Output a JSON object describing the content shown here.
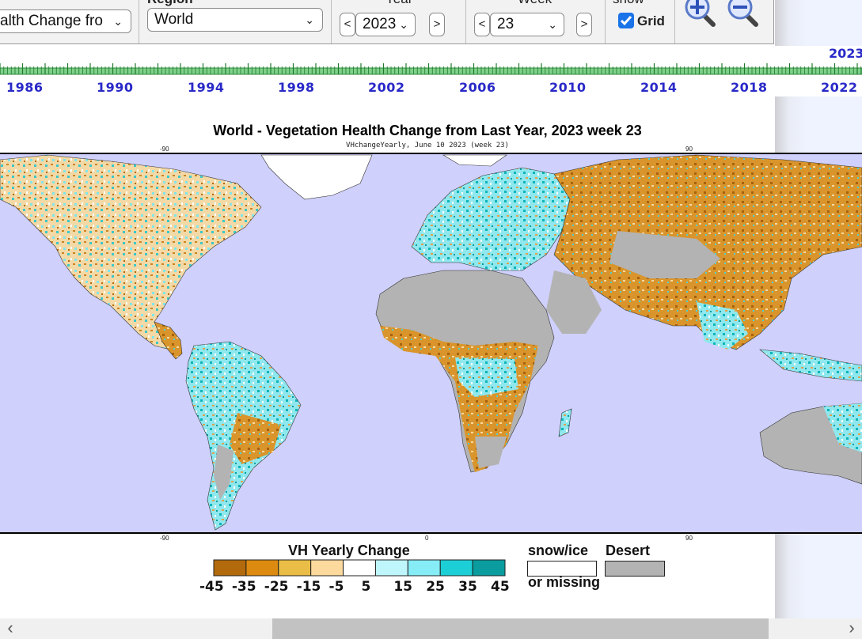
{
  "toolbar": {
    "product_value": "alth Change fro",
    "region_label": "Region",
    "region_value": "World",
    "year_label": "Year",
    "year_value": "2023",
    "week_label": "Week",
    "week_value": "23",
    "show_label": "show",
    "grid_label": "Grid",
    "grid_checked": true,
    "prev_symbol": "<",
    "next_symbol": ">"
  },
  "timeline": {
    "years": [
      "1986",
      "1990",
      "1994",
      "1998",
      "2002",
      "2006",
      "2010",
      "2014",
      "2018",
      "2022"
    ],
    "current_year": "2023"
  },
  "map": {
    "title": "World - Vegetation Health Change from Last Year, 2023 week 23",
    "subtitle": "VHchangeYearly,  June 10 2023 (week 23)",
    "lon_labels_top": [
      "-90",
      "90"
    ],
    "lon_labels_bottom": [
      "-90",
      "0",
      "90"
    ]
  },
  "legend": {
    "title": "VH Yearly Change",
    "ticks": [
      "-45",
      "-35",
      "-25",
      "-15",
      "-5",
      "5",
      "15",
      "25",
      "35",
      "45"
    ],
    "colors": [
      "#b26a0c",
      "#dd8a10",
      "#eabd46",
      "#fcd99d",
      "#ffffff",
      "#bff6fb",
      "#86ecf5",
      "#1ccfd6",
      "#0a9c9e"
    ],
    "snow_label": "snow/ice",
    "missing_label": "or missing",
    "desert_label": "Desert",
    "desert_color": "#b3b3b3"
  },
  "icons": [
    "zoom-in-icon",
    "zoom-out-icon",
    "chevron-down-icon",
    "scroll-left-icon",
    "scroll-right-icon"
  ]
}
